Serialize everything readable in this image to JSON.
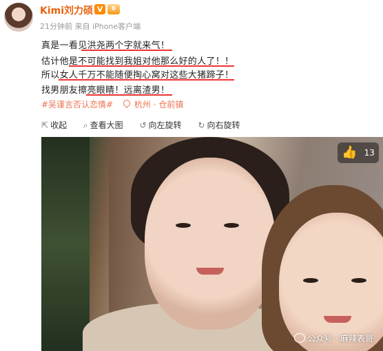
{
  "user": {
    "name": "Kimi刘力硕",
    "vip_badge": "V",
    "level_badge": "6",
    "meta": "21分钟前 来自 iPhone客户端"
  },
  "post": {
    "lines": [
      "真是一看见洪尧两个字就来气！",
      "估计他是不可能找到我姐对他那么好的人了！！",
      "所以女人千万不能随便掏心窝对这些大猪蹄子！",
      "找男朋友擦亮眼睛！远离渣男！"
    ],
    "topic_tag": "#吴谨言否认恋情#",
    "location": "杭州 · 仓前镇"
  },
  "toolbar": {
    "collapse": "收起",
    "view_large": "查看大图",
    "rotate_left": "向左旋转",
    "rotate_right": "向右旋转"
  },
  "photo": {
    "like_count": "13",
    "watermark": "公众号 · 麻辣表哥"
  },
  "colors": {
    "username": "#e8620f",
    "underline": "#e33333",
    "tag": "#eb7350"
  },
  "icons": [
    "vip-icon",
    "level-icon",
    "location-icon",
    "collapse-icon",
    "search-icon",
    "rotate-left-icon",
    "rotate-right-icon",
    "thumbs-up-icon",
    "wechat-icon"
  ]
}
